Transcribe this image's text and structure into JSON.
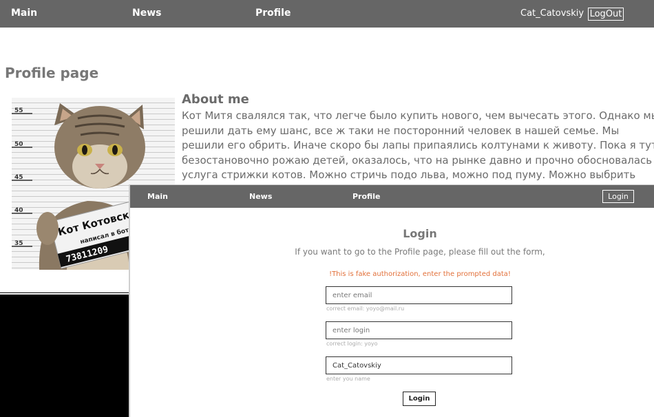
{
  "nav": {
    "main": "Main",
    "news": "News",
    "profile": "Profile",
    "username": "Cat_Catovskiy",
    "logout": "LogOut"
  },
  "page": {
    "title": "Profile page",
    "about_title": "About me",
    "about_text": "Кот Митя свалялся так, что легче было купить нового, чем вычесать этого. Однако мы решили дать ему шанс, все ж таки не посторонний человек в нашей семье. Мы решили его обрить. Иначе скоро бы лапы припаялись колтунами к животу. Пока я тут безостановочно рожаю детей, оказалось, что на рынке давно и прочно обосновалась услуга стрижки котов. Можно стричь подо льва, можно под пуму. Можно выбрить фигурный ирокез. Вариантов стрижки",
    "photo": {
      "sign_title": "Кот Котовский",
      "sign_line": "написал в ботинок",
      "sign_number": "73811209",
      "height_marks": [
        "55",
        "50",
        "45",
        "40",
        "35"
      ]
    }
  },
  "overlay": {
    "nav": {
      "main": "Main",
      "news": "News",
      "profile": "Profile",
      "login": "Login"
    },
    "form": {
      "title": "Login",
      "subtitle": "If you want to go to the Profile page, please fill out the form,",
      "warning": "!This is fake authorization, enter the prompted data!",
      "email_placeholder": "enter email",
      "email_value": "",
      "email_hint": "correct email: yoyo@mail.ru",
      "login_placeholder": "enter login",
      "login_value": "",
      "login_hint": "correct login: yoyo",
      "name_placeholder": "enter you name",
      "name_value": "Cat_Catovskiy",
      "name_hint": "enter you name",
      "submit": "Login"
    }
  },
  "colors": {
    "nav_bg": "#666666",
    "text": "#6b6b6b",
    "warning": "#e2703a"
  }
}
